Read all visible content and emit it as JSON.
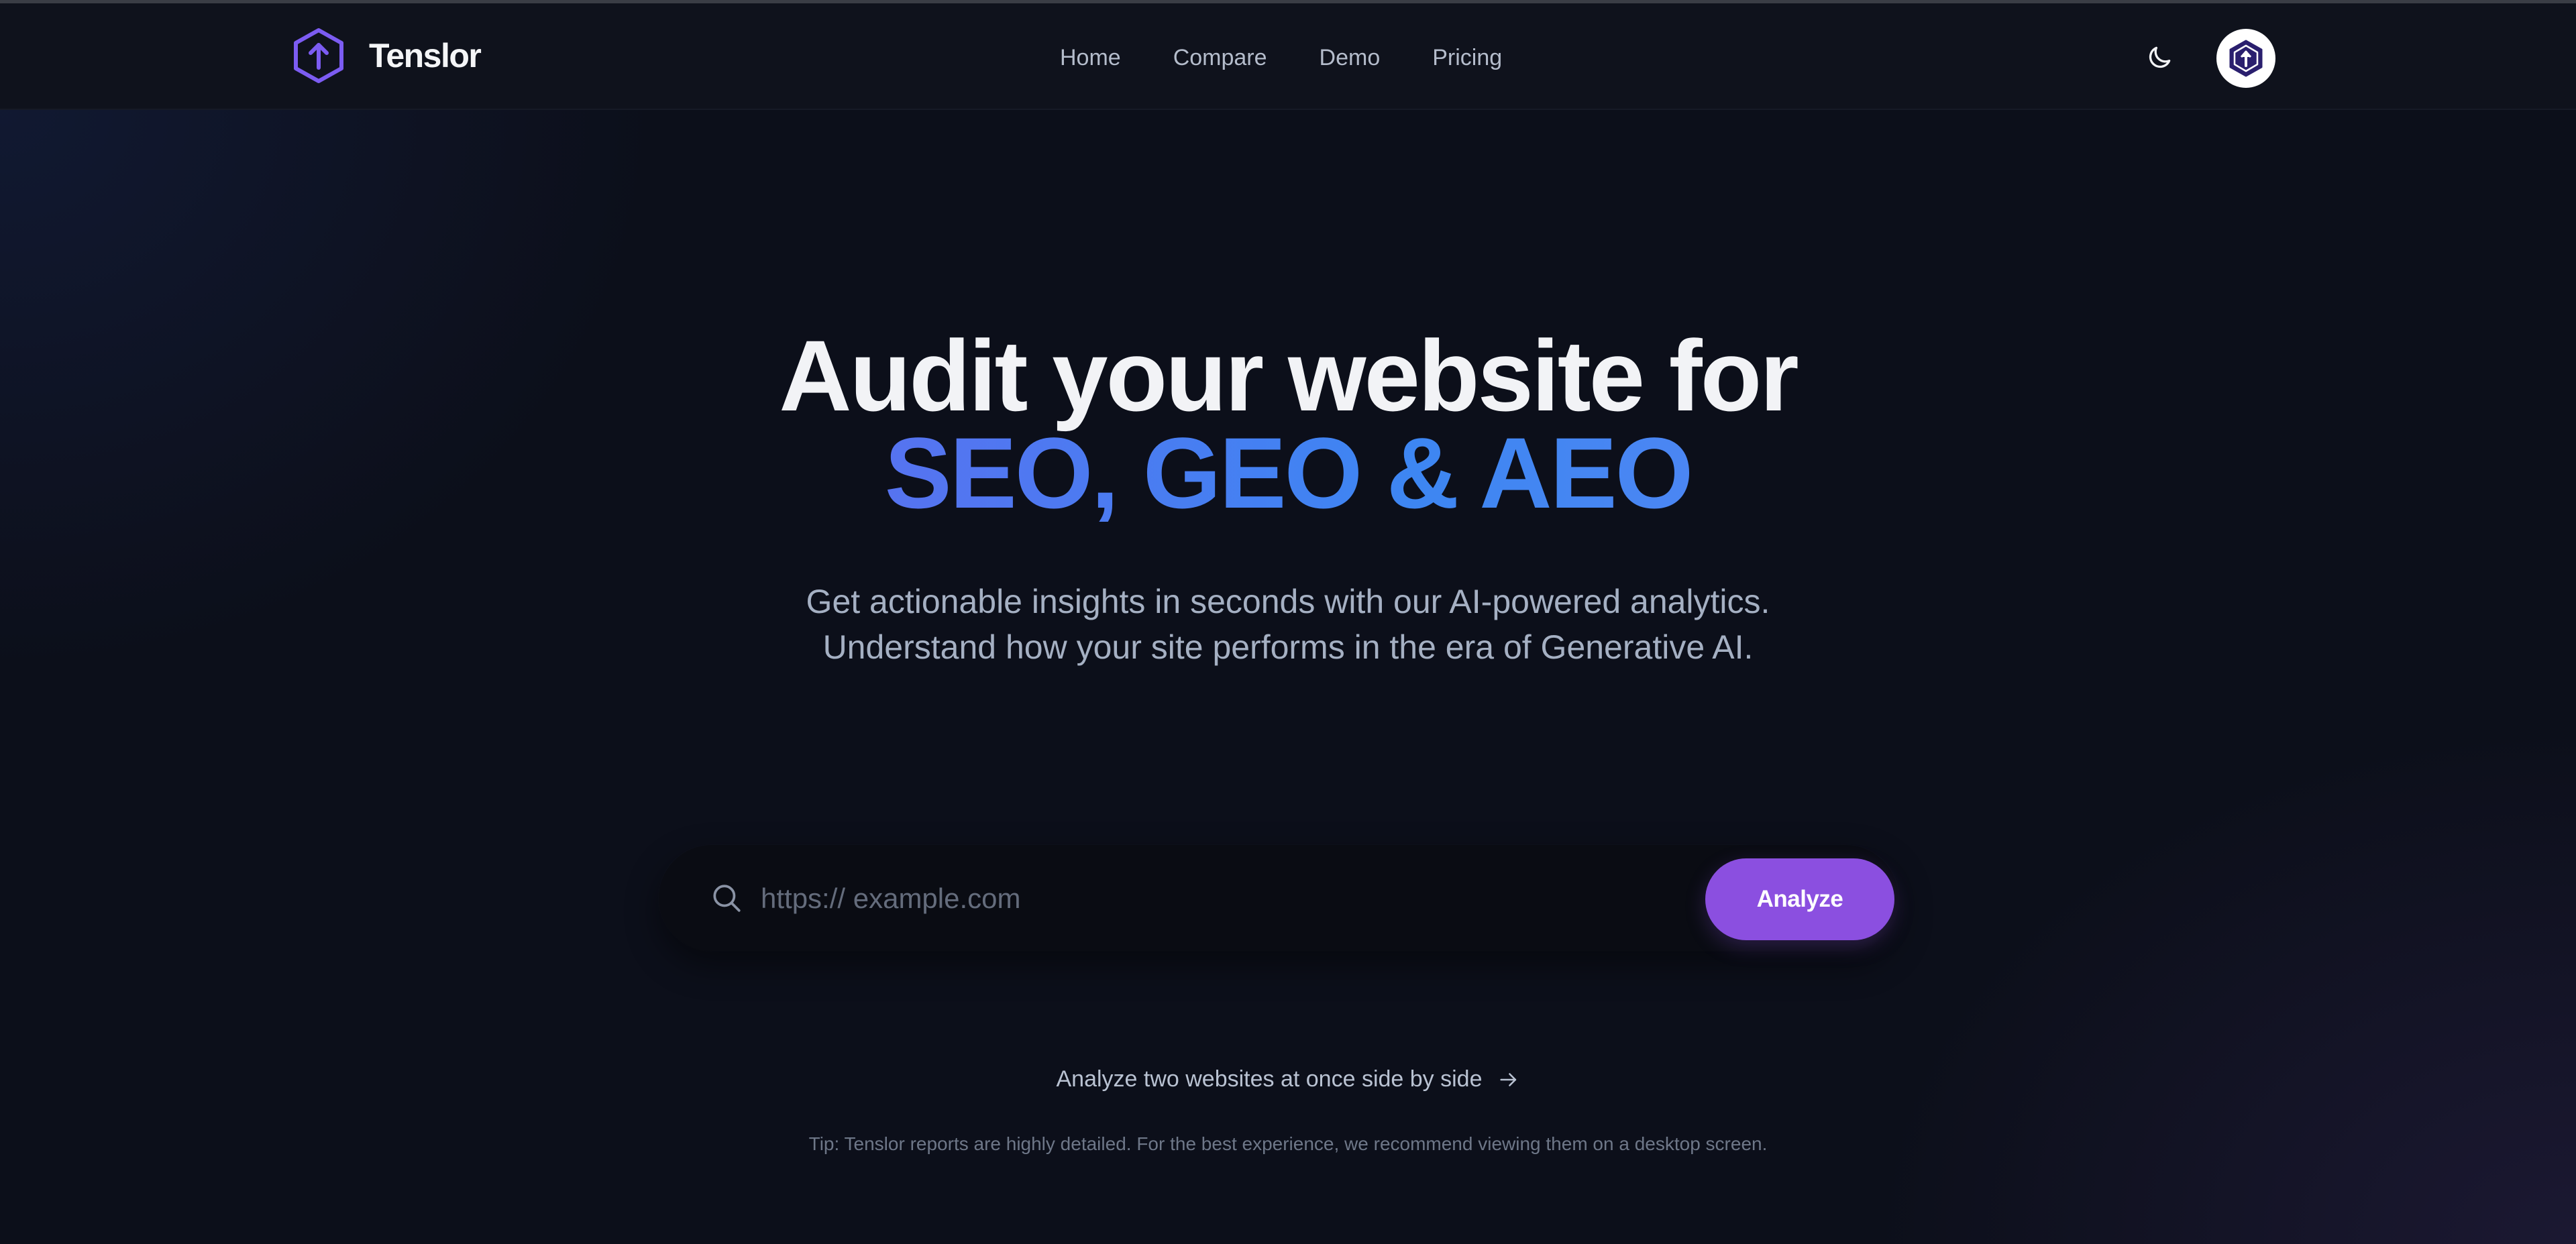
{
  "brand": {
    "name": "Tenslor",
    "logo_icon": "hexagon-up-arrow-icon",
    "accent_color": "#7c5cf2"
  },
  "nav": {
    "items": [
      {
        "label": "Home"
      },
      {
        "label": "Compare"
      },
      {
        "label": "Demo"
      },
      {
        "label": "Pricing"
      }
    ]
  },
  "header_actions": {
    "theme_toggle_icon": "moon-icon",
    "avatar_icon": "hexagon-up-arrow-icon"
  },
  "hero": {
    "title_line1": "Audit your website for",
    "title_line2": "SEO, GEO & AEO",
    "subtitle_line1": "Get actionable insights in seconds with our AI-powered analytics.",
    "subtitle_line2": "Understand how your site performs in the era of Generative AI."
  },
  "search": {
    "placeholder": "https:// example.com",
    "value": "",
    "icon": "search-icon",
    "button_label": "Analyze",
    "button_color": "#8b4fe0"
  },
  "compare_link": {
    "label": "Analyze two websites at once side by side",
    "icon": "arrow-right-icon"
  },
  "tip": {
    "text": "Tip: Tenslor reports are highly detailed. For the best experience, we recommend viewing them on a desktop screen."
  }
}
